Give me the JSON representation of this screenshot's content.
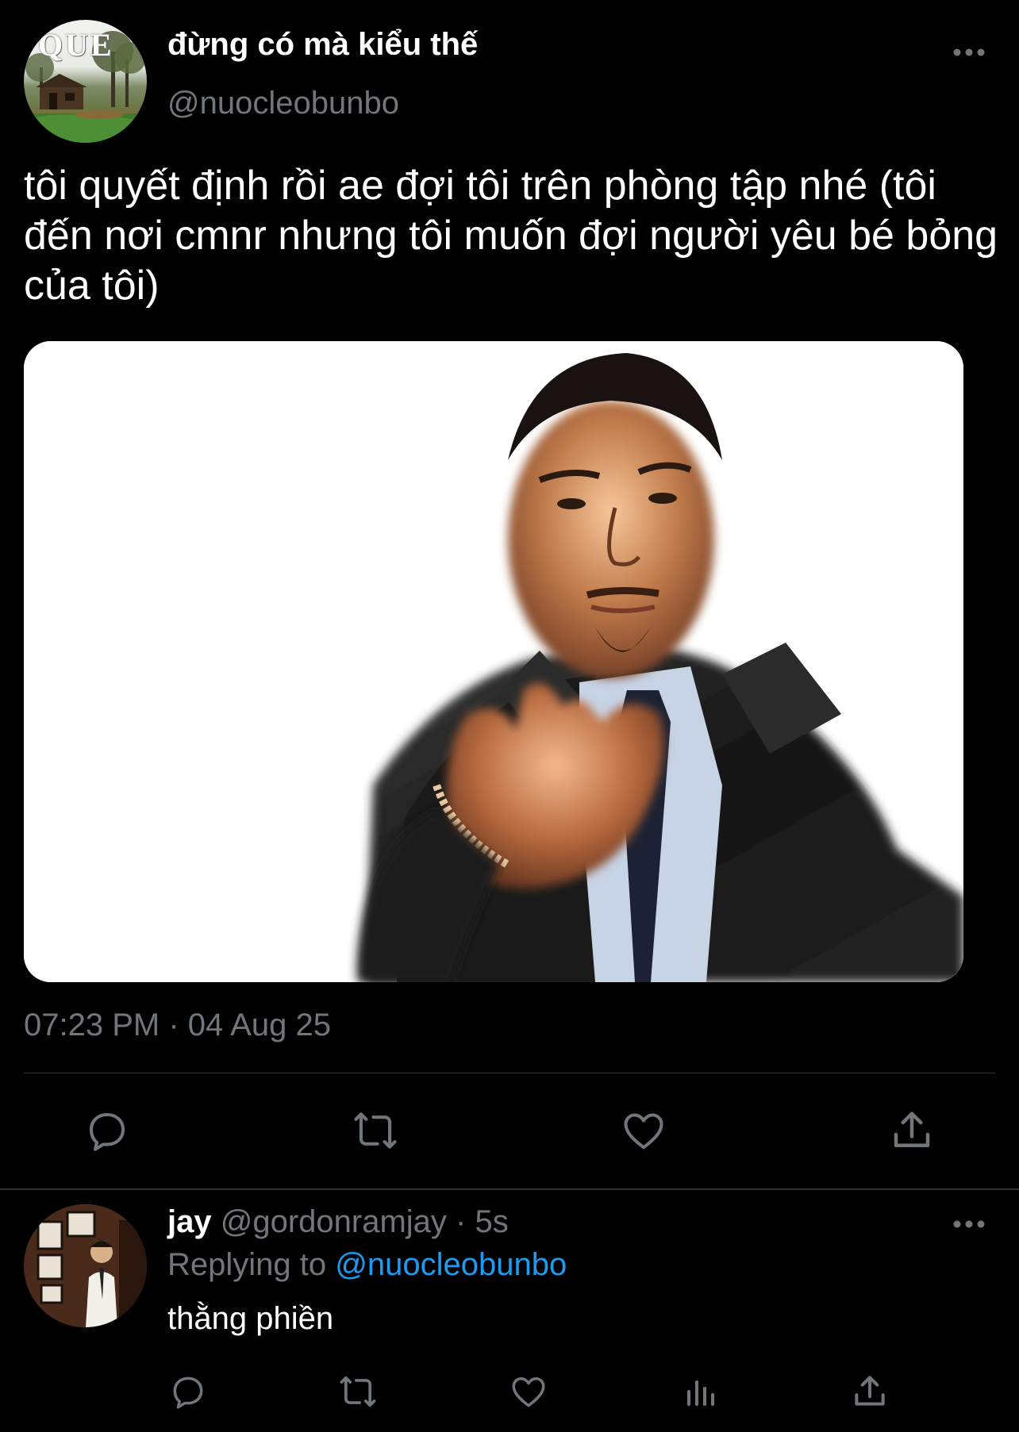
{
  "tweet": {
    "avatar_text": "QUE",
    "display_name": "đừng có mà kiểu thế",
    "handle": "@nuocleobunbo",
    "text": "tôi quyết định rồi ae đợi tôi trên phòng tập nhé (tôi đến nơi cmnr nhưng tôi muốn đợi người yêu bé bỏng của tôi)",
    "timestamp": "07:23 PM · 04 Aug 25",
    "actions": [
      "reply-icon",
      "retweet-icon",
      "like-icon",
      "share-icon"
    ]
  },
  "reply": {
    "name": "jay",
    "handle": "@gordonramjay",
    "time": "5s",
    "separator": " · ",
    "replying_prefix": "Replying to ",
    "replying_to": "@nuocleobunbo",
    "text": "thằng phiền",
    "actions": [
      "reply-icon",
      "retweet-icon",
      "like-icon",
      "analytics-icon",
      "share-icon"
    ]
  },
  "colors": {
    "background": "#000000",
    "text": "#ffffff",
    "secondary": "#71767b",
    "link": "#1d9bf0",
    "divider": "#2f3336"
  }
}
